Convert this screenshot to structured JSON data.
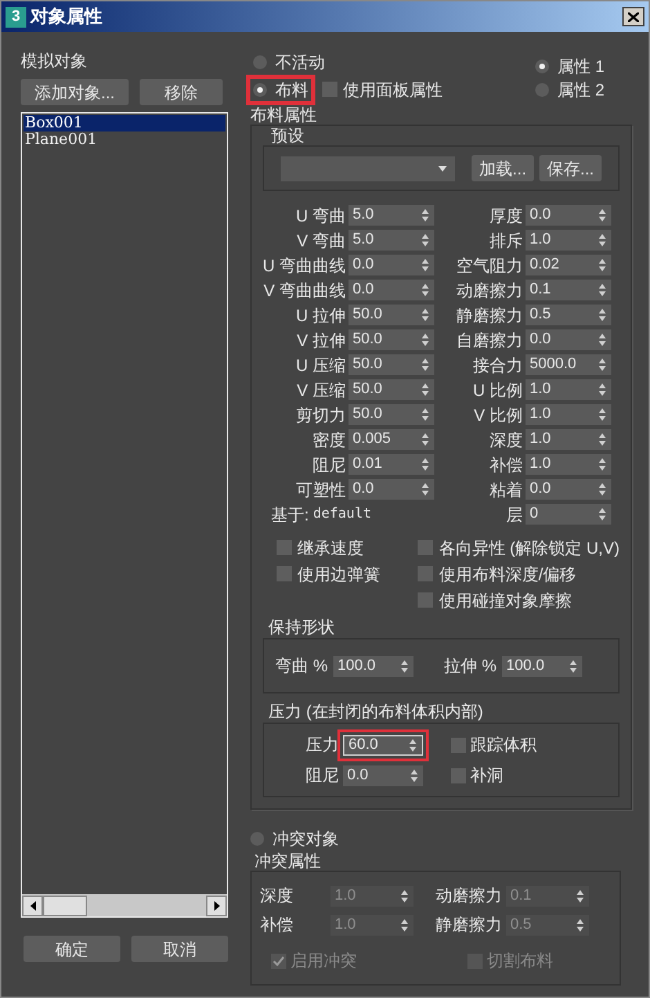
{
  "window": {
    "badge": "3",
    "title": "对象属性"
  },
  "objects": {
    "label": "模拟对象",
    "buttons": [
      "添加对象...",
      "移除"
    ],
    "items": [
      {
        "label": "Box001",
        "selected": true
      },
      {
        "label": "Plane001",
        "selected": false
      }
    ]
  },
  "modes": [
    {
      "label": "不活动",
      "selected": false,
      "highlighted": false
    },
    {
      "label": "布料",
      "selected": true,
      "highlighted": true
    }
  ],
  "use_panel": {
    "label": "使用面板属性",
    "checked": false
  },
  "property_sets": [
    {
      "label": "属性 1",
      "selected": true
    },
    {
      "label": "属性 2",
      "selected": false
    }
  ],
  "cloth": {
    "title": "布料属性",
    "preset": {
      "title": "预设",
      "buttons": [
        "加载...",
        "保存..."
      ]
    },
    "left": [
      {
        "label": "U 弯曲",
        "value": "5.0"
      },
      {
        "label": "V 弯曲",
        "value": "5.0"
      },
      {
        "label": "U 弯曲曲线",
        "value": "0.0"
      },
      {
        "label": "V 弯曲曲线",
        "value": "0.0"
      },
      {
        "label": "U 拉伸",
        "value": "50.0"
      },
      {
        "label": "V 拉伸",
        "value": "50.0"
      },
      {
        "label": "U 压缩",
        "value": "50.0"
      },
      {
        "label": "V 压缩",
        "value": "50.0"
      },
      {
        "label": "剪切力",
        "value": "50.0"
      },
      {
        "label": "密度",
        "value": "0.005"
      },
      {
        "label": "阻尼",
        "value": "0.01"
      },
      {
        "label": "可塑性",
        "value": "0.0"
      }
    ],
    "based_on": {
      "label": "基于:",
      "value": "default"
    },
    "right": [
      {
        "label": "厚度",
        "value": "0.0"
      },
      {
        "label": "排斥",
        "value": "1.0"
      },
      {
        "label": "空气阻力",
        "value": "0.02"
      },
      {
        "label": "动磨擦力",
        "value": "0.1"
      },
      {
        "label": "静磨擦力",
        "value": "0.5"
      },
      {
        "label": "自磨擦力",
        "value": "0.0"
      },
      {
        "label": "接合力",
        "value": "5000.0"
      },
      {
        "label": "U 比例",
        "value": "1.0"
      },
      {
        "label": "V 比例",
        "value": "1.0"
      },
      {
        "label": "深度",
        "value": "1.0"
      },
      {
        "label": "补偿",
        "value": "1.0"
      },
      {
        "label": "粘着",
        "value": "0.0"
      },
      {
        "label": "层",
        "value": "0"
      }
    ],
    "options_left": [
      {
        "label": "继承速度",
        "checked": false
      },
      {
        "label": "使用边弹簧",
        "checked": false
      }
    ],
    "options_right": [
      {
        "label": "各向异性 (解除锁定 U,V)",
        "checked": false
      },
      {
        "label": "使用布料深度/偏移",
        "checked": false
      },
      {
        "label": "使用碰撞对象摩擦",
        "checked": false
      }
    ],
    "keep_shape": {
      "title": "保持形状",
      "fields": [
        {
          "label": "弯曲 %",
          "value": "100.0"
        },
        {
          "label": "拉伸 %",
          "value": "100.0"
        }
      ]
    },
    "pressure": {
      "title": "压力 (在封闭的布料体积内部)",
      "fields": [
        {
          "label": "压力",
          "value": "60.0",
          "highlighted": true
        },
        {
          "label": "阻尼",
          "value": "0.0",
          "highlighted": false
        }
      ],
      "checks": [
        {
          "label": "跟踪体积",
          "checked": false
        },
        {
          "label": "补洞",
          "checked": false
        }
      ]
    }
  },
  "collision_mode": {
    "label": "冲突对象",
    "selected": false
  },
  "collision": {
    "title": "冲突属性",
    "disabled": true,
    "fields": [
      {
        "label": "深度",
        "value": "1.0"
      },
      {
        "label": "动磨擦力",
        "value": "0.1"
      },
      {
        "label": "补偿",
        "value": "1.0"
      },
      {
        "label": "静磨擦力",
        "value": "0.5"
      }
    ],
    "checks": [
      {
        "label": "启用冲突",
        "checked": true
      },
      {
        "label": "切割布料",
        "checked": false
      }
    ]
  },
  "footer": {
    "buttons": [
      "确定",
      "取消"
    ]
  }
}
